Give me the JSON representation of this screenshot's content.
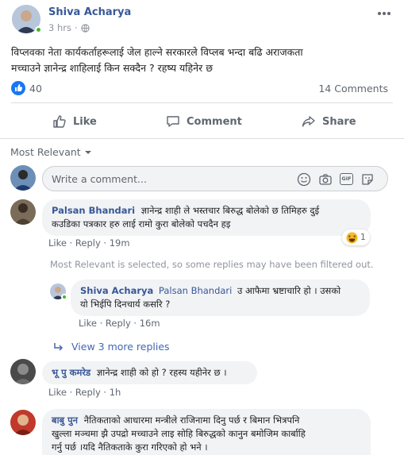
{
  "post": {
    "author": "Shiva Acharya",
    "time": "3 hrs",
    "privacy_icon": "globe-icon",
    "more_icon": "more-options-icon",
    "text_line1": "विप्लवका नेता कार्यकर्ताहरूलाई जेल हाल्ने सरकारले विप्लब भन्दा बढि अराजकता",
    "text_line2": "मच्चाउने ज्ञानेन्द्र शाहिलाई किन सक्दैन ? रहष्य यहिनेर छ",
    "like_count": "40",
    "comment_count": "14 Comments"
  },
  "actions": {
    "like": "Like",
    "comment": "Comment",
    "share": "Share"
  },
  "sort": {
    "label": "Most Relevant"
  },
  "composer": {
    "placeholder": "Write a comment...",
    "icons": [
      "emoji-icon",
      "camera-icon",
      "gif-icon",
      "sticker-icon"
    ],
    "gif_label": "GIF"
  },
  "comments": [
    {
      "author": "Palsan Bhandari",
      "text_line1": "ज्ञानेन्द्र शाही ले भस्तचार बिरुद्ध बोलेको छ तिमिहरु दुई",
      "text_line2": "कउडिका पत्रकार हरु लाई रामो कुरा बोलेको पचदैन हइ",
      "like": "Like",
      "reply": "Reply",
      "time": "19m",
      "reaction_count": "1"
    },
    {
      "author": "भू पु कमरेड",
      "text_line1": "ज्ञानेन्द्र शाही को हो ? रहस्य यहीनेर छ ।",
      "like": "Like",
      "reply": "Reply",
      "time": "1h"
    },
    {
      "author": "बाबु पुन",
      "text_line1": "नैतिकताको आधारमा मन्त्रीले राजिनामा दिनु पर्छ र बिमान भित्रपनि",
      "text_line2": "खुल्ला मञ्चमा झै उपद्रो मच्चाउने लाइ सोहि बिरुद्धको कानुन बमोजिम कार्बाहि",
      "text_line3": "गर्नु पर्छ ।यदि नैतिकताके कुरा गरिएको हो भने ।"
    }
  ],
  "filter_notice": "Most Relevant is selected, so some replies may have been filtered out.",
  "reply": {
    "author": "Shiva Acharya",
    "mention": "Palsan Bhandari",
    "text_line1": "उ आफैमा भ्रष्टाचारि हो । उसको",
    "text_line2": "यो भिईपि दिनचार्य कसरि ?",
    "like": "Like",
    "reply": "Reply",
    "time": "16m"
  },
  "view_replies": "View 3 more replies",
  "colors": {
    "link": "#385898",
    "accent": "#4267b2",
    "online": "#42b72a"
  }
}
